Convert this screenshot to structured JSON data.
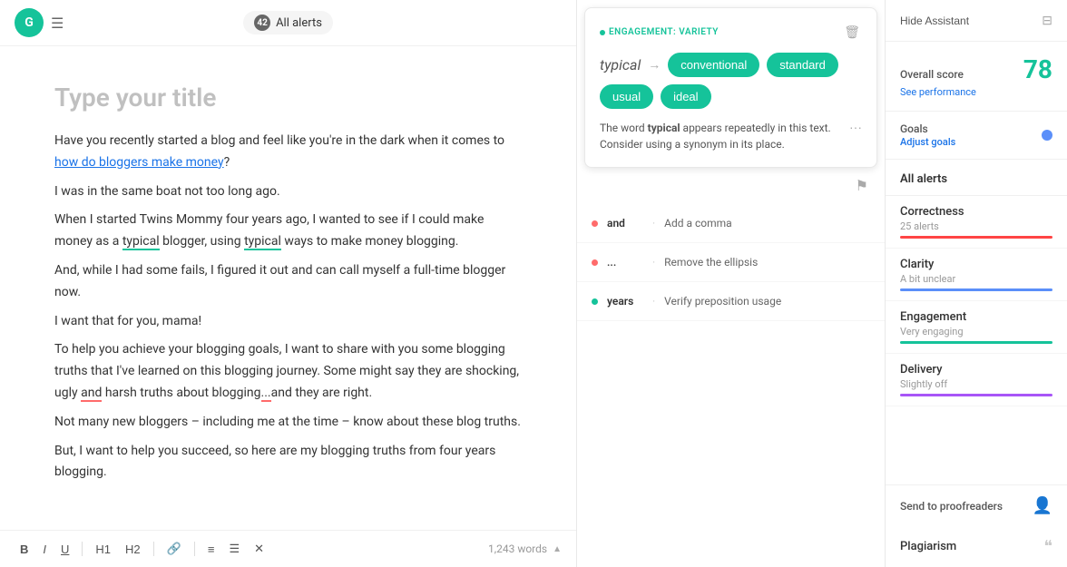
{
  "header": {
    "alerts_count": "42",
    "alerts_label": "All alerts",
    "hide_assistant": "Hide Assistant"
  },
  "editor": {
    "title": "Type your title",
    "body": [
      "Have you recently started a blog and feel like you're in the dark when it comes to how do bloggers make money?",
      "I was in the same boat not too long ago.",
      "When I started Twins Mommy four years ago, I wanted to see if I could make money as a typical blogger, using typical ways to make money blogging.",
      "And, while I had some fails, I figured it out and can call myself a full-time blogger now.",
      "I want that for you, mama!",
      "To help you achieve your blogging goals, I want to share with you some blogging truths that I've learned on this blogging journey. Some might say they are shocking, ugly and harsh truths about blogging...and they are right.",
      "Not many new bloggers – including me at the time – know about these blog truths.",
      "But, I want to help you succeed, so here are my blogging truths from four years blogging."
    ],
    "word_count": "1,243 words",
    "link_text": "how do bloggers make money"
  },
  "toolbar": {
    "bold": "B",
    "italic": "I",
    "underline": "U",
    "h1": "H1",
    "h2": "H2",
    "word_count": "1,243 words"
  },
  "engagement_card": {
    "tag": "ENGAGEMENT: VARIETY",
    "original": "typical",
    "suggestions": [
      "conventional",
      "standard",
      "usual",
      "ideal"
    ],
    "explanation": "The word typical appears repeatedly in this text. Consider using a synonym in its place."
  },
  "alerts_list": [
    {
      "dot_color": "dot-red",
      "word": "and",
      "separator": "·",
      "description": "Add a comma"
    },
    {
      "dot_color": "dot-red",
      "word": "...",
      "separator": "·",
      "description": "Remove the ellipsis"
    },
    {
      "dot_color": "dot-green",
      "word": "years",
      "separator": "·",
      "description": "Verify preposition usage"
    }
  ],
  "sidebar": {
    "overall_score_label": "Overall score",
    "overall_score": "78",
    "see_performance": "See performance",
    "goals_label": "Goals",
    "adjust_goals": "Adjust goals",
    "all_alerts_label": "All alerts",
    "metrics": [
      {
        "name": "Correctness",
        "sub": "25 alerts",
        "bar_class": "bar-correctness"
      },
      {
        "name": "Clarity",
        "sub": "A bit unclear",
        "bar_class": "bar-clarity"
      },
      {
        "name": "Engagement",
        "sub": "Very engaging",
        "bar_class": "bar-engagement"
      },
      {
        "name": "Delivery",
        "sub": "Slightly off",
        "bar_class": "bar-delivery"
      }
    ],
    "send_to_proofreaders": "Send to proofreaders",
    "plagiarism": "Plagiarism"
  }
}
